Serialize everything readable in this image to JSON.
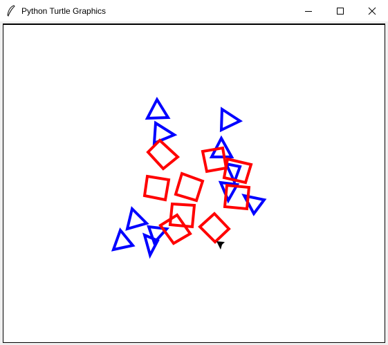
{
  "window": {
    "title": "Python Turtle Graphics",
    "controls": {
      "minimize_icon": "minimize-icon",
      "maximize_icon": "maximize-icon",
      "close_icon": "close-icon"
    }
  },
  "canvas": {
    "background": "#ffffff",
    "colors": {
      "triangles": "#0000ff",
      "squares": "#ff0000",
      "turtle": "#000000"
    }
  }
}
